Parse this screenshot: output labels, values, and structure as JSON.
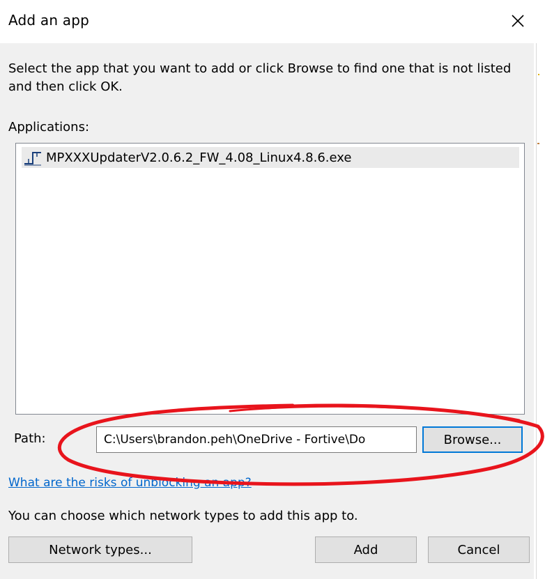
{
  "window": {
    "title": "Add an app",
    "close_icon": "close-icon"
  },
  "instructions": "Select the app that you want to add or click Browse to find one that is not listed and then click OK.",
  "applications": {
    "label": "Applications:",
    "items": [
      {
        "name": "MPXXXUpdaterV2.0.6.2_FW_4.08_Linux4.8.6.exe",
        "icon": "app-exe-icon",
        "selected": true
      }
    ]
  },
  "path": {
    "label": "Path:",
    "value": "C:\\Users\\brandon.peh\\OneDrive - Fortive\\Do"
  },
  "buttons": {
    "browse": "Browse...",
    "network_types": "Network types...",
    "add": "Add",
    "cancel": "Cancel"
  },
  "risk_link": "What are the risks of unblocking an app?",
  "network_note": "You can choose which network types to add this app to.",
  "colors": {
    "dialog_background": "#f0f0f0",
    "focus_border": "#0078d7",
    "link": "#0066cc",
    "annotation": "#e8141c"
  }
}
